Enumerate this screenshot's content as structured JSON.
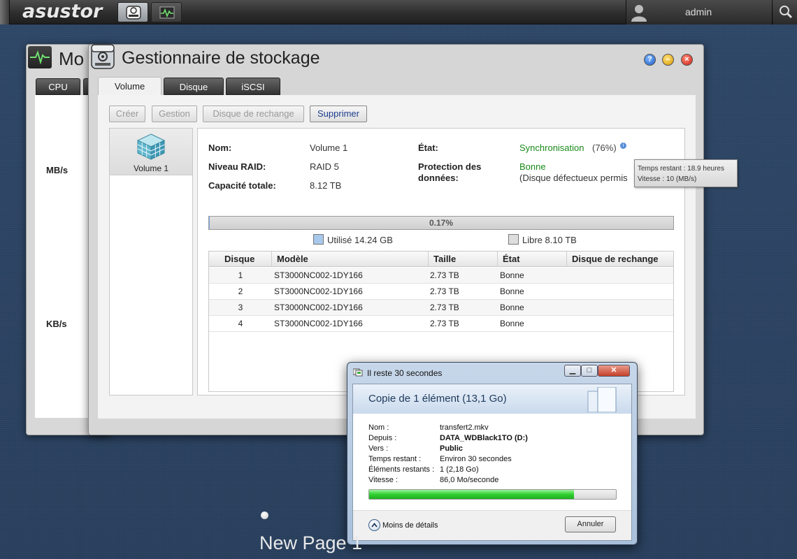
{
  "topbar": {
    "logo": "asustor",
    "user_name": "admin"
  },
  "monitor_window": {
    "title": "Mo",
    "tab_cpu": "CPU",
    "unit_mbs": "MB/s",
    "unit_kbs": "KB/s"
  },
  "storage_window": {
    "title": "Gestionnaire de stockage",
    "tabs": [
      {
        "label": "Volume",
        "active": true
      },
      {
        "label": "Disque",
        "active": false
      },
      {
        "label": "iSCSI",
        "active": false
      }
    ],
    "toolbar": {
      "create": "Créer",
      "manage": "Gestion",
      "spare": "Disque de rechange",
      "delete": "Supprimer"
    },
    "volumes": [
      {
        "label": "Volume 1"
      }
    ],
    "details": {
      "name_label": "Nom:",
      "name_value": "Volume 1",
      "raid_label": "Niveau RAID:",
      "raid_value": "RAID 5",
      "capacity_label": "Capacité totale:",
      "capacity_value": "8.12 TB",
      "state_label": "État:",
      "state_value": "Synchronisation",
      "state_percent": "(76%)",
      "protection_label_1": "Protection des",
      "protection_label_2": "données:",
      "protection_value": "Bonne",
      "protection_note": "(Disque défectueux permis"
    },
    "usage": {
      "percent_label": "0.17%",
      "used_fraction": 0.0017,
      "used_label": "Utilisé 14.24 GB",
      "free_label": "Libre 8.10 TB",
      "used_color": "#a8c8ec",
      "free_color": "#dedede"
    },
    "disk_table": {
      "headers": [
        "Disque",
        "Modèle",
        "Taille",
        "État",
        "Disque de rechange"
      ],
      "rows": [
        [
          "1",
          "ST3000NC002-1DY166",
          "2.73 TB",
          "Bonne",
          ""
        ],
        [
          "2",
          "ST3000NC002-1DY166",
          "2.73 TB",
          "Bonne",
          ""
        ],
        [
          "3",
          "ST3000NC002-1DY166",
          "2.73 TB",
          "Bonne",
          ""
        ],
        [
          "4",
          "ST3000NC002-1DY166",
          "2.73 TB",
          "Bonne",
          ""
        ]
      ]
    }
  },
  "tooltip": {
    "line1": "Temps restant : 18.9 heures",
    "line2": "Vitesse : 10 (MB/s)"
  },
  "copy_dialog": {
    "title": "Il reste 30 secondes",
    "header": "Copie de 1 élément (13,1 Go)",
    "fields": [
      {
        "label": "Nom :",
        "value": "transfert2.mkv",
        "bold": false
      },
      {
        "label": "Depuis :",
        "value": "DATA_WDBlack1TO (D:)",
        "bold": true
      },
      {
        "label": "Vers :",
        "value": "Public",
        "bold": true
      },
      {
        "label": "Temps restant :",
        "value": "Environ 30 secondes",
        "bold": false
      },
      {
        "label": "Éléments restants :",
        "value": "1 (2,18 Go)",
        "bold": false
      },
      {
        "label": "Vitesse :",
        "value": "86,0 Mo/seconde",
        "bold": false
      }
    ],
    "progress_fraction": 0.83,
    "less_details": "Moins de détails",
    "cancel": "Annuler"
  },
  "page_nav": {
    "label": "New Page 1"
  }
}
